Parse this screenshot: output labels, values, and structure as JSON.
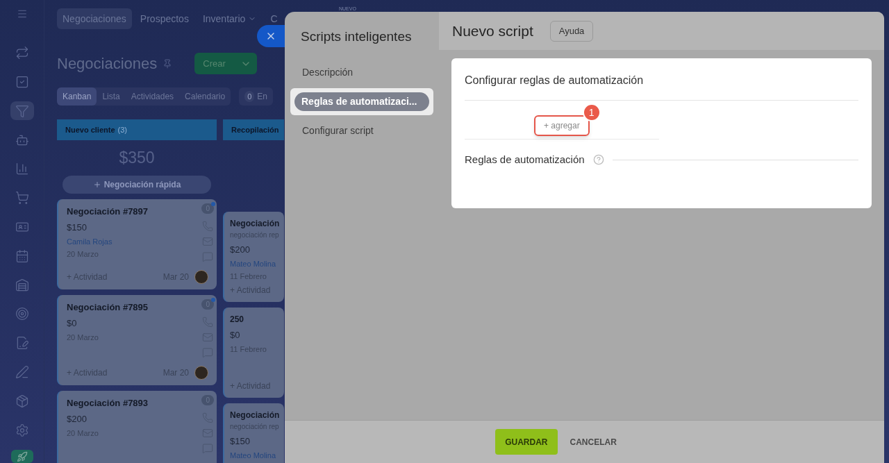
{
  "new_badge": "NUEVO",
  "nav_tabs": [
    {
      "label": "Negociaciones",
      "selected": true,
      "dropdown": false
    },
    {
      "label": "Prospectos",
      "selected": false,
      "dropdown": false
    },
    {
      "label": "Inventario",
      "selected": false,
      "dropdown": true
    },
    {
      "label": "C",
      "selected": false,
      "dropdown": false
    }
  ],
  "page_title": "Negociaciones",
  "create_button": "Crear",
  "view_tabs": [
    {
      "label": "Kanban",
      "selected": true
    },
    {
      "label": "Lista",
      "selected": false
    },
    {
      "label": "Actividades",
      "selected": false
    },
    {
      "label": "Calendario",
      "selected": false
    }
  ],
  "counter": {
    "count": "0",
    "label": "En"
  },
  "columns": [
    {
      "title": "Nuevo cliente",
      "count": "(3)",
      "total": "$350",
      "quick_add": "Negociación rápida",
      "cards": [
        {
          "title": "Negociación #7897",
          "amount": "$150",
          "contact": "Camila Rojas",
          "date": "20 Marzo",
          "activity": "+ Actividad",
          "due": "Mar 20",
          "badge": "0",
          "unread": true
        },
        {
          "title": "Negociación #7895",
          "amount": "$0",
          "date": "20 Marzo",
          "activity": "+ Actividad",
          "due": "Mar 20",
          "badge": "0",
          "unread": true
        },
        {
          "title": "Negociación #7893",
          "amount": "$200",
          "date": "20 Marzo",
          "badge": "0",
          "unread": false
        }
      ]
    },
    {
      "title": "Recopilación",
      "cards": [
        {
          "title": "Negociación",
          "subtitle": "negociación rep",
          "amount": "$200",
          "contact": "Mateo Molina",
          "date": "11 Febrero",
          "activity": "+ Actividad"
        },
        {
          "title": "250",
          "amount": "$0",
          "date": "11 Febrero",
          "activity": "+ Actividad"
        },
        {
          "title": "Negociación",
          "subtitle": "negociación rep",
          "amount": "$150",
          "contact": "Mateo Molina"
        }
      ]
    }
  ],
  "panel": {
    "title": "Scripts inteligentes",
    "steps": [
      {
        "label": "Descripción",
        "selected": false
      },
      {
        "label": "Reglas de automatizaci...",
        "selected": true
      },
      {
        "label": "Configurar script",
        "selected": false
      }
    ],
    "header": "Nuevo script",
    "help_button": "Ayuda",
    "card_title": "Configurar reglas de automatización",
    "add_button": "+ agregar",
    "callout": "1",
    "rules_label": "Reglas de automatización",
    "save_button": "GUARDAR",
    "cancel_button": "CANCELAR"
  }
}
